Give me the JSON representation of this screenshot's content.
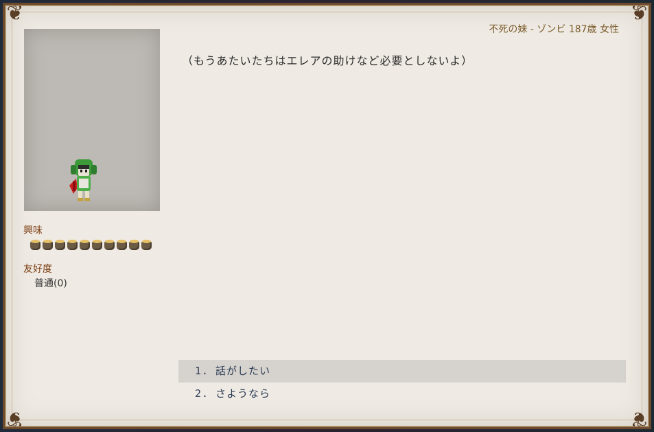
{
  "header": {
    "title": "不死の妹 - ゾンビ 187歳 女性"
  },
  "dialog": {
    "text": "（もうあたいたちはエレアの助けなど必要としないよ）"
  },
  "status": {
    "interest_label": "興味",
    "interest_level": 10,
    "interest_max": 10,
    "affinity_label": "友好度",
    "affinity_value": "普通(0)"
  },
  "choices": [
    {
      "num": "1.",
      "label": "話がしたい",
      "selected": true
    },
    {
      "num": "2.",
      "label": "さようなら",
      "selected": false
    }
  ],
  "colors": {
    "frame": "#6b4a2e",
    "paper": "#efebe4",
    "label_brown": "#7a3c10",
    "choice_text": "#2c3b55",
    "title_text": "#7a5a2a"
  }
}
